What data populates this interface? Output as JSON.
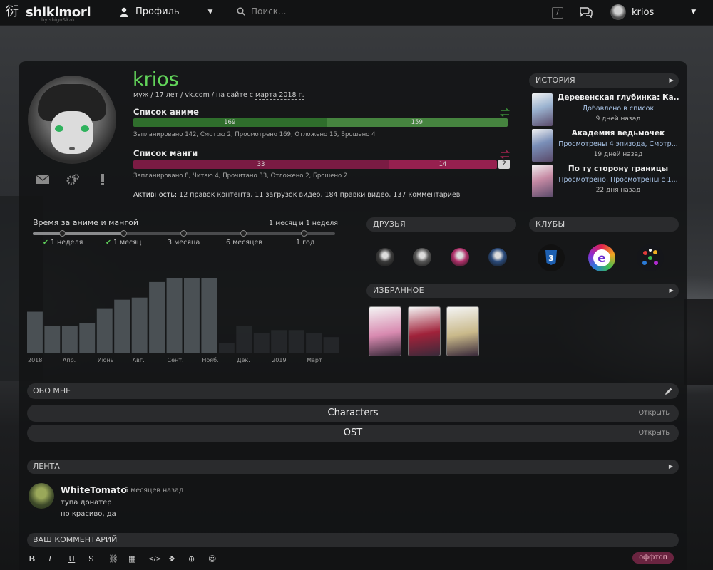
{
  "header": {
    "logo_text": "shikimori",
    "logo_sub": "by shigo&kak",
    "profile_menu": "Профиль",
    "search_placeholder": "Поиск...",
    "slash_key": "/",
    "username": "krios"
  },
  "profile": {
    "name": "krios",
    "info_prefix": "муж / 17 лет / vk.com / на сайте с ",
    "info_since": "марта 2018 г.",
    "anime": {
      "title": "Список аниме",
      "bar_values": [
        169,
        159
      ],
      "bar_colors": [
        "#2f6e2c",
        "#46843f"
      ],
      "summary": "Запланировано 142, Смотрю 2, Просмотрено 169, Отложено 15, Брошено 4"
    },
    "manga": {
      "title": "Список манги",
      "bar_values": [
        33,
        14
      ],
      "end_value": 2,
      "bar_colors": [
        "#7a1b43",
        "#96204f"
      ],
      "summary": "Запланировано 8, Читаю 4, Прочитано 33, Отложено 2, Брошено 2"
    },
    "activity_label": "Активность:",
    "activity_text": " 12 правок контента, 11 загрузок видео, 184 правки видео, 137 комментариев"
  },
  "history": {
    "title": "ИСТОРИЯ",
    "items": [
      {
        "title": "Деревенская глубинка: Ка...",
        "action": "Добавлено в список",
        "date": "9 дней назад",
        "color": "#9bb3d0"
      },
      {
        "title": "Академия ведьмочек",
        "action": "Просмотрены 4 эпизода, Смотр...",
        "date": "19 дней назад",
        "color": "#7a8fb8"
      },
      {
        "title": "По ту сторону границы",
        "action": "Просмотрено, Просмотрены с 1...",
        "date": "22 дня назад",
        "color": "#c68aa4"
      }
    ]
  },
  "time": {
    "title": "Время за аниме и мангой",
    "value": "1 месяц и 1 неделя",
    "marks": [
      {
        "label": "1 неделя",
        "checked": true
      },
      {
        "label": "1 месяц",
        "checked": true
      },
      {
        "label": "3 месяца",
        "checked": false
      },
      {
        "label": "6 месяцев",
        "checked": false
      },
      {
        "label": "1 год",
        "checked": false
      }
    ]
  },
  "chart_data": {
    "type": "bar",
    "categories": [
      "2018",
      "",
      "Апр.",
      "",
      "Июнь",
      "",
      "Авг.",
      "",
      "Сент.",
      "",
      "Нояб.",
      "",
      "Дек.",
      "",
      "2019",
      "",
      "Март",
      ""
    ],
    "values": [
      58,
      38,
      38,
      42,
      63,
      75,
      78,
      100,
      106,
      106,
      106,
      0,
      0,
      0,
      0,
      0,
      0,
      0
    ],
    "ghost_values": [
      0,
      0,
      0,
      0,
      0,
      0,
      0,
      0,
      0,
      0,
      0,
      14,
      38,
      28,
      32,
      32,
      28,
      22
    ],
    "title": "",
    "xlabel": "",
    "ylabel": ""
  },
  "friends": {
    "title": "ДРУЗЬЯ",
    "colors": [
      "#3a3a3a",
      "#555",
      "#b0306a",
      "#2a4a7a"
    ]
  },
  "clubs": {
    "title": "КЛУБЫ",
    "items": [
      {
        "icon": "css3-icon",
        "color": "#1d5fb0"
      },
      {
        "icon": "e-letter-icon",
        "color": "#7a2ad0"
      },
      {
        "icon": "spiral-icon",
        "color": "#d07020"
      }
    ]
  },
  "favorites": {
    "title": "ИЗБРАННОЕ",
    "colors": [
      "#d88ab0",
      "#a0223a",
      "#c9b98a"
    ]
  },
  "about": {
    "title": "ОБО МНЕ",
    "spoilers": [
      {
        "title": "Characters",
        "open": "Открыть"
      },
      {
        "title": "OST",
        "open": "Открыть"
      }
    ]
  },
  "feed": {
    "title": "ЛЕНТА",
    "user": "WhiteTomato",
    "time": "5 месяцев назад",
    "lines": [
      "тупа донатер",
      "но красиво, да"
    ]
  },
  "comment": {
    "title": "ВАШ КОММЕНТАРИЙ",
    "tools": [
      "B",
      "I",
      "U",
      "S",
      "⛓",
      "▦",
      "</>",
      "❖",
      "⊕",
      "☺"
    ],
    "offtop": "оффтоп"
  }
}
